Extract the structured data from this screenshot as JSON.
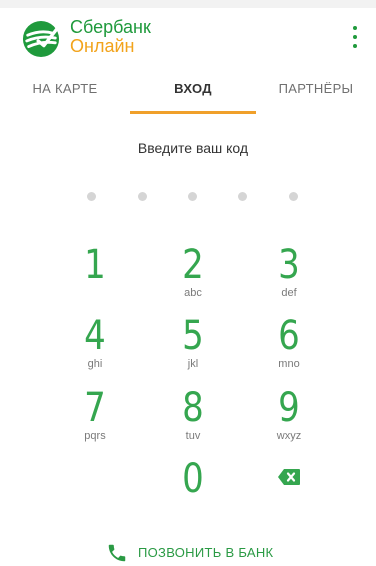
{
  "app": {
    "brand_line1": "Сбербанк",
    "brand_line2": "Онлайн",
    "brand_color": "#1f9a3c",
    "brand_accent": "#f2a31b"
  },
  "tabs": [
    {
      "label": "НА КАРТЕ",
      "active": false
    },
    {
      "label": "ВХОД",
      "active": true
    },
    {
      "label": "ПАРТНЁРЫ",
      "active": false
    }
  ],
  "login": {
    "prompt": "Введите ваш код",
    "code_length": 5,
    "entered_digits": 0
  },
  "keypad": {
    "keys": [
      {
        "digit": "1",
        "letters": ""
      },
      {
        "digit": "2",
        "letters": "abc"
      },
      {
        "digit": "3",
        "letters": "def"
      },
      {
        "digit": "4",
        "letters": "ghi"
      },
      {
        "digit": "5",
        "letters": "jkl"
      },
      {
        "digit": "6",
        "letters": "mno"
      },
      {
        "digit": "7",
        "letters": "pqrs"
      },
      {
        "digit": "8",
        "letters": "tuv"
      },
      {
        "digit": "9",
        "letters": "wxyz"
      },
      {
        "digit": "0",
        "letters": ""
      }
    ],
    "digit_color": "#35a64f"
  },
  "footer": {
    "call_label": "ПОЗВОНИТЬ В БАНК"
  },
  "icons": {
    "logo": "sberbank-logo-icon",
    "menu": "more-vertical-icon",
    "backspace": "backspace-icon",
    "call": "phone-icon"
  }
}
